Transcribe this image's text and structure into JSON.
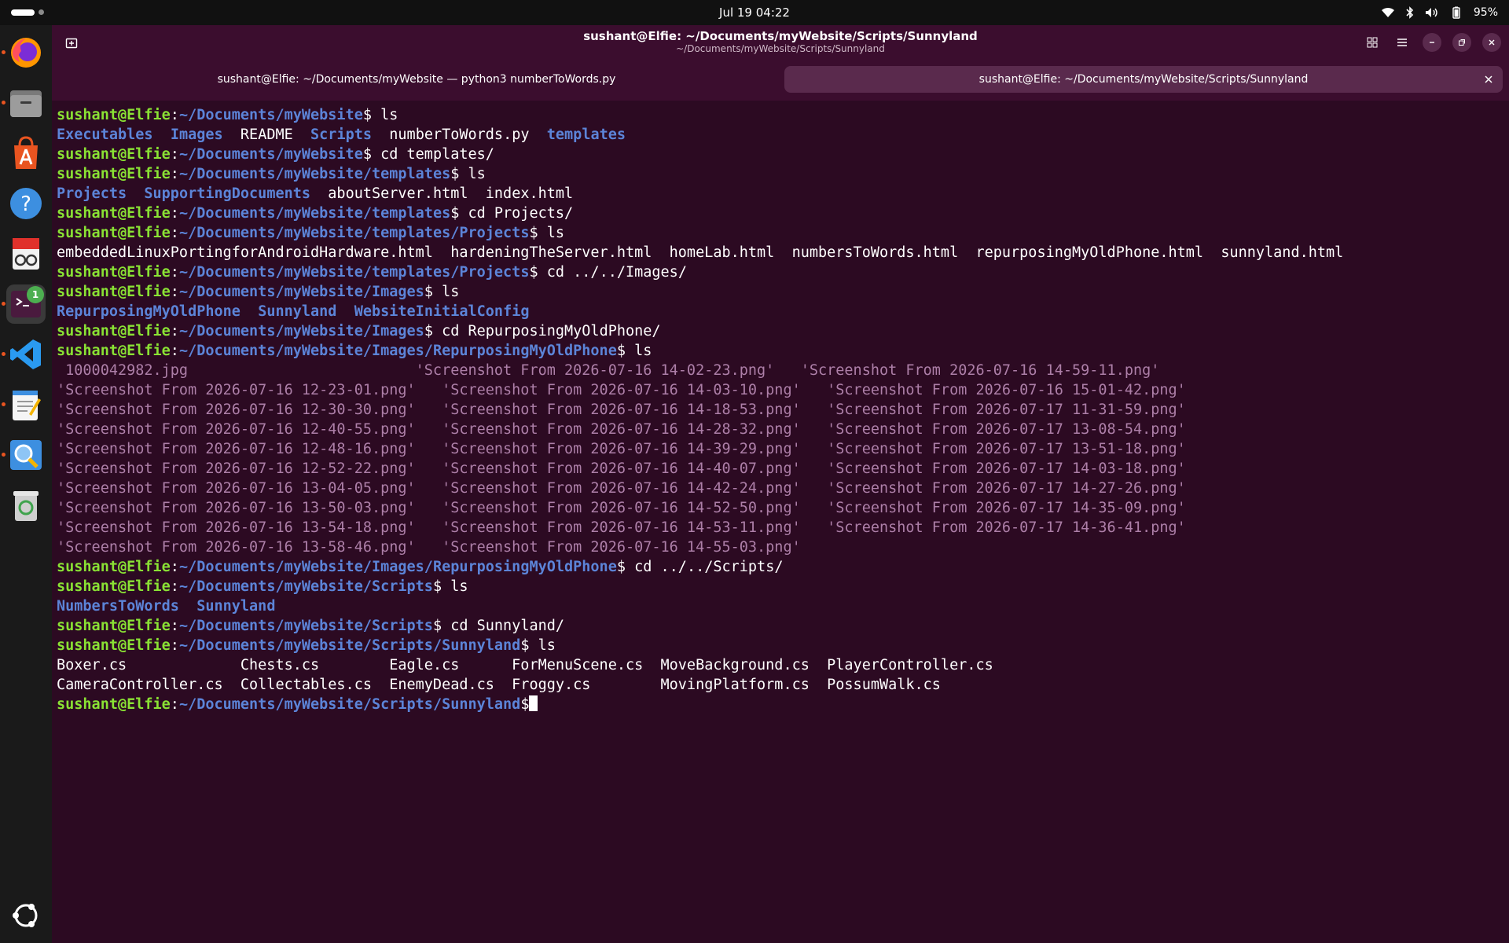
{
  "topbar": {
    "clock": "Jul 19  04:22",
    "battery": "95%"
  },
  "dock": {
    "items": [
      {
        "name": "firefox-icon",
        "running": true
      },
      {
        "name": "files-icon",
        "running": true
      },
      {
        "name": "app-center-icon",
        "running": false
      },
      {
        "name": "help-icon",
        "running": false
      },
      {
        "name": "document-viewer-icon",
        "running": false
      },
      {
        "name": "terminal-icon",
        "running": true,
        "badge": "1",
        "active": true
      },
      {
        "name": "vscode-icon",
        "running": true
      },
      {
        "name": "text-editor-icon",
        "running": true
      },
      {
        "name": "image-viewer-icon",
        "running": true
      },
      {
        "name": "trash-icon",
        "running": false
      },
      {
        "name": "show-apps-icon",
        "running": false
      }
    ]
  },
  "window": {
    "title": "sushant@Elfie: ~/Documents/myWebsite/Scripts/Sunnyland",
    "subtitle": "~/Documents/myWebsite/Scripts/Sunnyland",
    "tabs": [
      {
        "label": "sushant@Elfie: ~/Documents/myWebsite — python3 numberToWords.py"
      },
      {
        "label": "sushant@Elfie: ~/Documents/myWebsite/Scripts/Sunnyland"
      }
    ]
  },
  "colors": {
    "user": "#8ae234",
    "path": "#5c84d8",
    "directory": "#5c84d8",
    "image_file": "#ad7fa8",
    "background": "#2c0a22"
  },
  "terminal": {
    "user": "sushant@Elfie",
    "lines": [
      {
        "type": "prompt",
        "path": "~/Documents/myWebsite",
        "cmd": " ls"
      },
      {
        "type": "out",
        "segs": [
          {
            "t": "Executables",
            "c": "d"
          },
          {
            "t": "  "
          },
          {
            "t": "Images",
            "c": "d"
          },
          {
            "t": "  README  "
          },
          {
            "t": "Scripts",
            "c": "d"
          },
          {
            "t": "  numberToWords.py  "
          },
          {
            "t": "templates",
            "c": "d"
          }
        ]
      },
      {
        "type": "prompt",
        "path": "~/Documents/myWebsite",
        "cmd": " cd templates/"
      },
      {
        "type": "prompt",
        "path": "~/Documents/myWebsite/templates",
        "cmd": " ls"
      },
      {
        "type": "out",
        "segs": [
          {
            "t": "Projects",
            "c": "d"
          },
          {
            "t": "  "
          },
          {
            "t": "SupportingDocuments",
            "c": "d"
          },
          {
            "t": "  aboutServer.html  index.html"
          }
        ]
      },
      {
        "type": "prompt",
        "path": "~/Documents/myWebsite/templates",
        "cmd": " cd Projects/"
      },
      {
        "type": "prompt",
        "path": "~/Documents/myWebsite/templates/Projects",
        "cmd": " ls"
      },
      {
        "type": "out",
        "segs": [
          {
            "t": "embeddedLinuxPortingforAndroidHardware.html  hardeningTheServer.html  homeLab.html  numbersToWords.html  repurposingMyOldPhone.html  sunnyland.html"
          }
        ]
      },
      {
        "type": "prompt",
        "path": "~/Documents/myWebsite/templates/Projects",
        "cmd": " cd ../../Images/"
      },
      {
        "type": "prompt",
        "path": "~/Documents/myWebsite/Images",
        "cmd": " ls"
      },
      {
        "type": "out",
        "segs": [
          {
            "t": "RepurposingMyOldPhone",
            "c": "d"
          },
          {
            "t": "  "
          },
          {
            "t": "Sunnyland",
            "c": "d"
          },
          {
            "t": "  "
          },
          {
            "t": "WebsiteInitialConfig",
            "c": "d"
          }
        ]
      },
      {
        "type": "prompt",
        "path": "~/Documents/myWebsite/Images",
        "cmd": " cd RepurposingMyOldPhone/"
      },
      {
        "type": "prompt",
        "path": "~/Documents/myWebsite/Images/RepurposingMyOldPhone",
        "cmd": " ls"
      },
      {
        "type": "out",
        "segs": [
          {
            "t": " 1000042982.jpg                          'Screenshot From 2026-07-16 14-02-23.png'   'Screenshot From 2026-07-16 14-59-11.png'",
            "c": "img"
          }
        ]
      },
      {
        "type": "out",
        "segs": [
          {
            "t": "'Screenshot From 2026-07-16 12-23-01.png'   'Screenshot From 2026-07-16 14-03-10.png'   'Screenshot From 2026-07-16 15-01-42.png'",
            "c": "img"
          }
        ]
      },
      {
        "type": "out",
        "segs": [
          {
            "t": "'Screenshot From 2026-07-16 12-30-30.png'   'Screenshot From 2026-07-16 14-18-53.png'   'Screenshot From 2026-07-17 11-31-59.png'",
            "c": "img"
          }
        ]
      },
      {
        "type": "out",
        "segs": [
          {
            "t": "'Screenshot From 2026-07-16 12-40-55.png'   'Screenshot From 2026-07-16 14-28-32.png'   'Screenshot From 2026-07-17 13-08-54.png'",
            "c": "img"
          }
        ]
      },
      {
        "type": "out",
        "segs": [
          {
            "t": "'Screenshot From 2026-07-16 12-48-16.png'   'Screenshot From 2026-07-16 14-39-29.png'   'Screenshot From 2026-07-17 13-51-18.png'",
            "c": "img"
          }
        ]
      },
      {
        "type": "out",
        "segs": [
          {
            "t": "'Screenshot From 2026-07-16 12-52-22.png'   'Screenshot From 2026-07-16 14-40-07.png'   'Screenshot From 2026-07-17 14-03-18.png'",
            "c": "img"
          }
        ]
      },
      {
        "type": "out",
        "segs": [
          {
            "t": "'Screenshot From 2026-07-16 13-04-05.png'   'Screenshot From 2026-07-16 14-42-24.png'   'Screenshot From 2026-07-17 14-27-26.png'",
            "c": "img"
          }
        ]
      },
      {
        "type": "out",
        "segs": [
          {
            "t": "'Screenshot From 2026-07-16 13-50-03.png'   'Screenshot From 2026-07-16 14-52-50.png'   'Screenshot From 2026-07-17 14-35-09.png'",
            "c": "img"
          }
        ]
      },
      {
        "type": "out",
        "segs": [
          {
            "t": "'Screenshot From 2026-07-16 13-54-18.png'   'Screenshot From 2026-07-16 14-53-11.png'   'Screenshot From 2026-07-17 14-36-41.png'",
            "c": "img"
          }
        ]
      },
      {
        "type": "out",
        "segs": [
          {
            "t": "'Screenshot From 2026-07-16 13-58-46.png'   'Screenshot From 2026-07-16 14-55-03.png'",
            "c": "img"
          }
        ]
      },
      {
        "type": "prompt",
        "path": "~/Documents/myWebsite/Images/RepurposingMyOldPhone",
        "cmd": " cd ../../Scripts/"
      },
      {
        "type": "prompt",
        "path": "~/Documents/myWebsite/Scripts",
        "cmd": " ls"
      },
      {
        "type": "out",
        "segs": [
          {
            "t": "NumbersToWords",
            "c": "d"
          },
          {
            "t": "  "
          },
          {
            "t": "Sunnyland",
            "c": "d"
          }
        ]
      },
      {
        "type": "prompt",
        "path": "~/Documents/myWebsite/Scripts",
        "cmd": " cd Sunnyland/"
      },
      {
        "type": "prompt",
        "path": "~/Documents/myWebsite/Scripts/Sunnyland",
        "cmd": " ls"
      },
      {
        "type": "out",
        "segs": [
          {
            "t": "Boxer.cs             Chests.cs        Eagle.cs      ForMenuScene.cs  MoveBackground.cs  PlayerController.cs"
          }
        ]
      },
      {
        "type": "out",
        "segs": [
          {
            "t": "CameraController.cs  Collectables.cs  EnemyDead.cs  Froggy.cs        MovingPlatform.cs  PossumWalk.cs"
          }
        ]
      },
      {
        "type": "prompt",
        "path": "~/Documents/myWebsite/Scripts/Sunnyland",
        "cmd": "",
        "cursor": true
      }
    ]
  }
}
